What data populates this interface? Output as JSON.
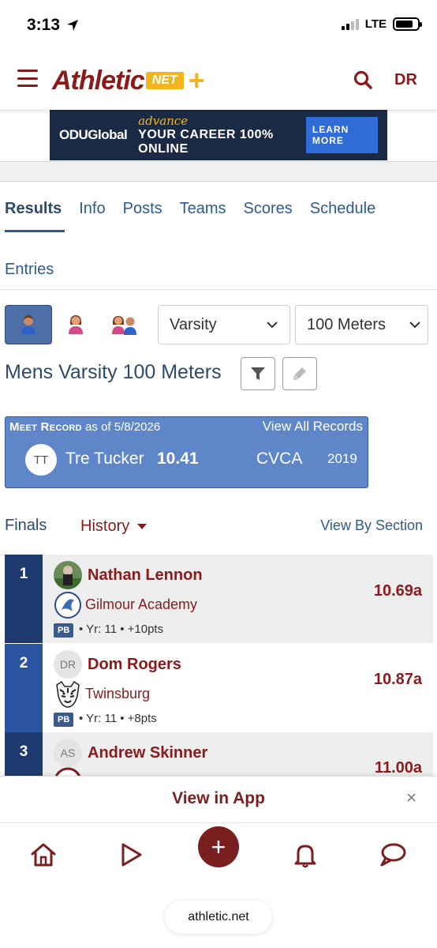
{
  "status_bar": {
    "time": "3:13",
    "network": "LTE"
  },
  "header": {
    "logo_main": "Athletic",
    "logo_net": "NET",
    "logo_plus": "+",
    "user_initials": "DR"
  },
  "ad": {
    "brand": "ODUGlobal",
    "line1": "advance",
    "line2": "YOUR CAREER 100% ONLINE",
    "button": "LEARN MORE"
  },
  "tabs": [
    "Results",
    "Info",
    "Posts",
    "Teams",
    "Scores",
    "Schedule"
  ],
  "tab_extra": "Entries",
  "filters": {
    "level": "Varsity",
    "event": "100 Meters"
  },
  "event_title": "Mens Varsity 100 Meters",
  "meet_record": {
    "label": "Meet Record",
    "as_of": "as of 5/8/2026",
    "view_all": "View All Records",
    "initials": "TT",
    "athlete": "Tre Tucker",
    "mark": "10.41",
    "team": "CVCA",
    "year": "2019"
  },
  "section": {
    "finals": "Finals",
    "history": "History",
    "view_by_section": "View By Section"
  },
  "results": [
    {
      "place": "1",
      "name": "Nathan Lennon",
      "initials": "",
      "team": "Gilmour Academy",
      "badge": "PB",
      "meta": "• Yr: 11 • +10pts",
      "mark": "10.69a"
    },
    {
      "place": "2",
      "name": "Dom Rogers",
      "initials": "DR",
      "team": "Twinsburg",
      "badge": "PB",
      "meta": "• Yr: 11 • +8pts",
      "mark": "10.87a"
    },
    {
      "place": "3",
      "name": "Andrew Skinner",
      "initials": "AS",
      "team": "",
      "badge": "",
      "meta": "",
      "mark": "11.00a"
    }
  ],
  "app_banner": {
    "text": "View in App",
    "close": "×"
  },
  "bottom_nav": {
    "plus": "+"
  },
  "url": "athletic.net",
  "colors": {
    "brand": "#8b1a1a",
    "accent": "#f2b51f",
    "primary_blue": "#2e5a8c",
    "record_blue": "#5e86c9"
  }
}
